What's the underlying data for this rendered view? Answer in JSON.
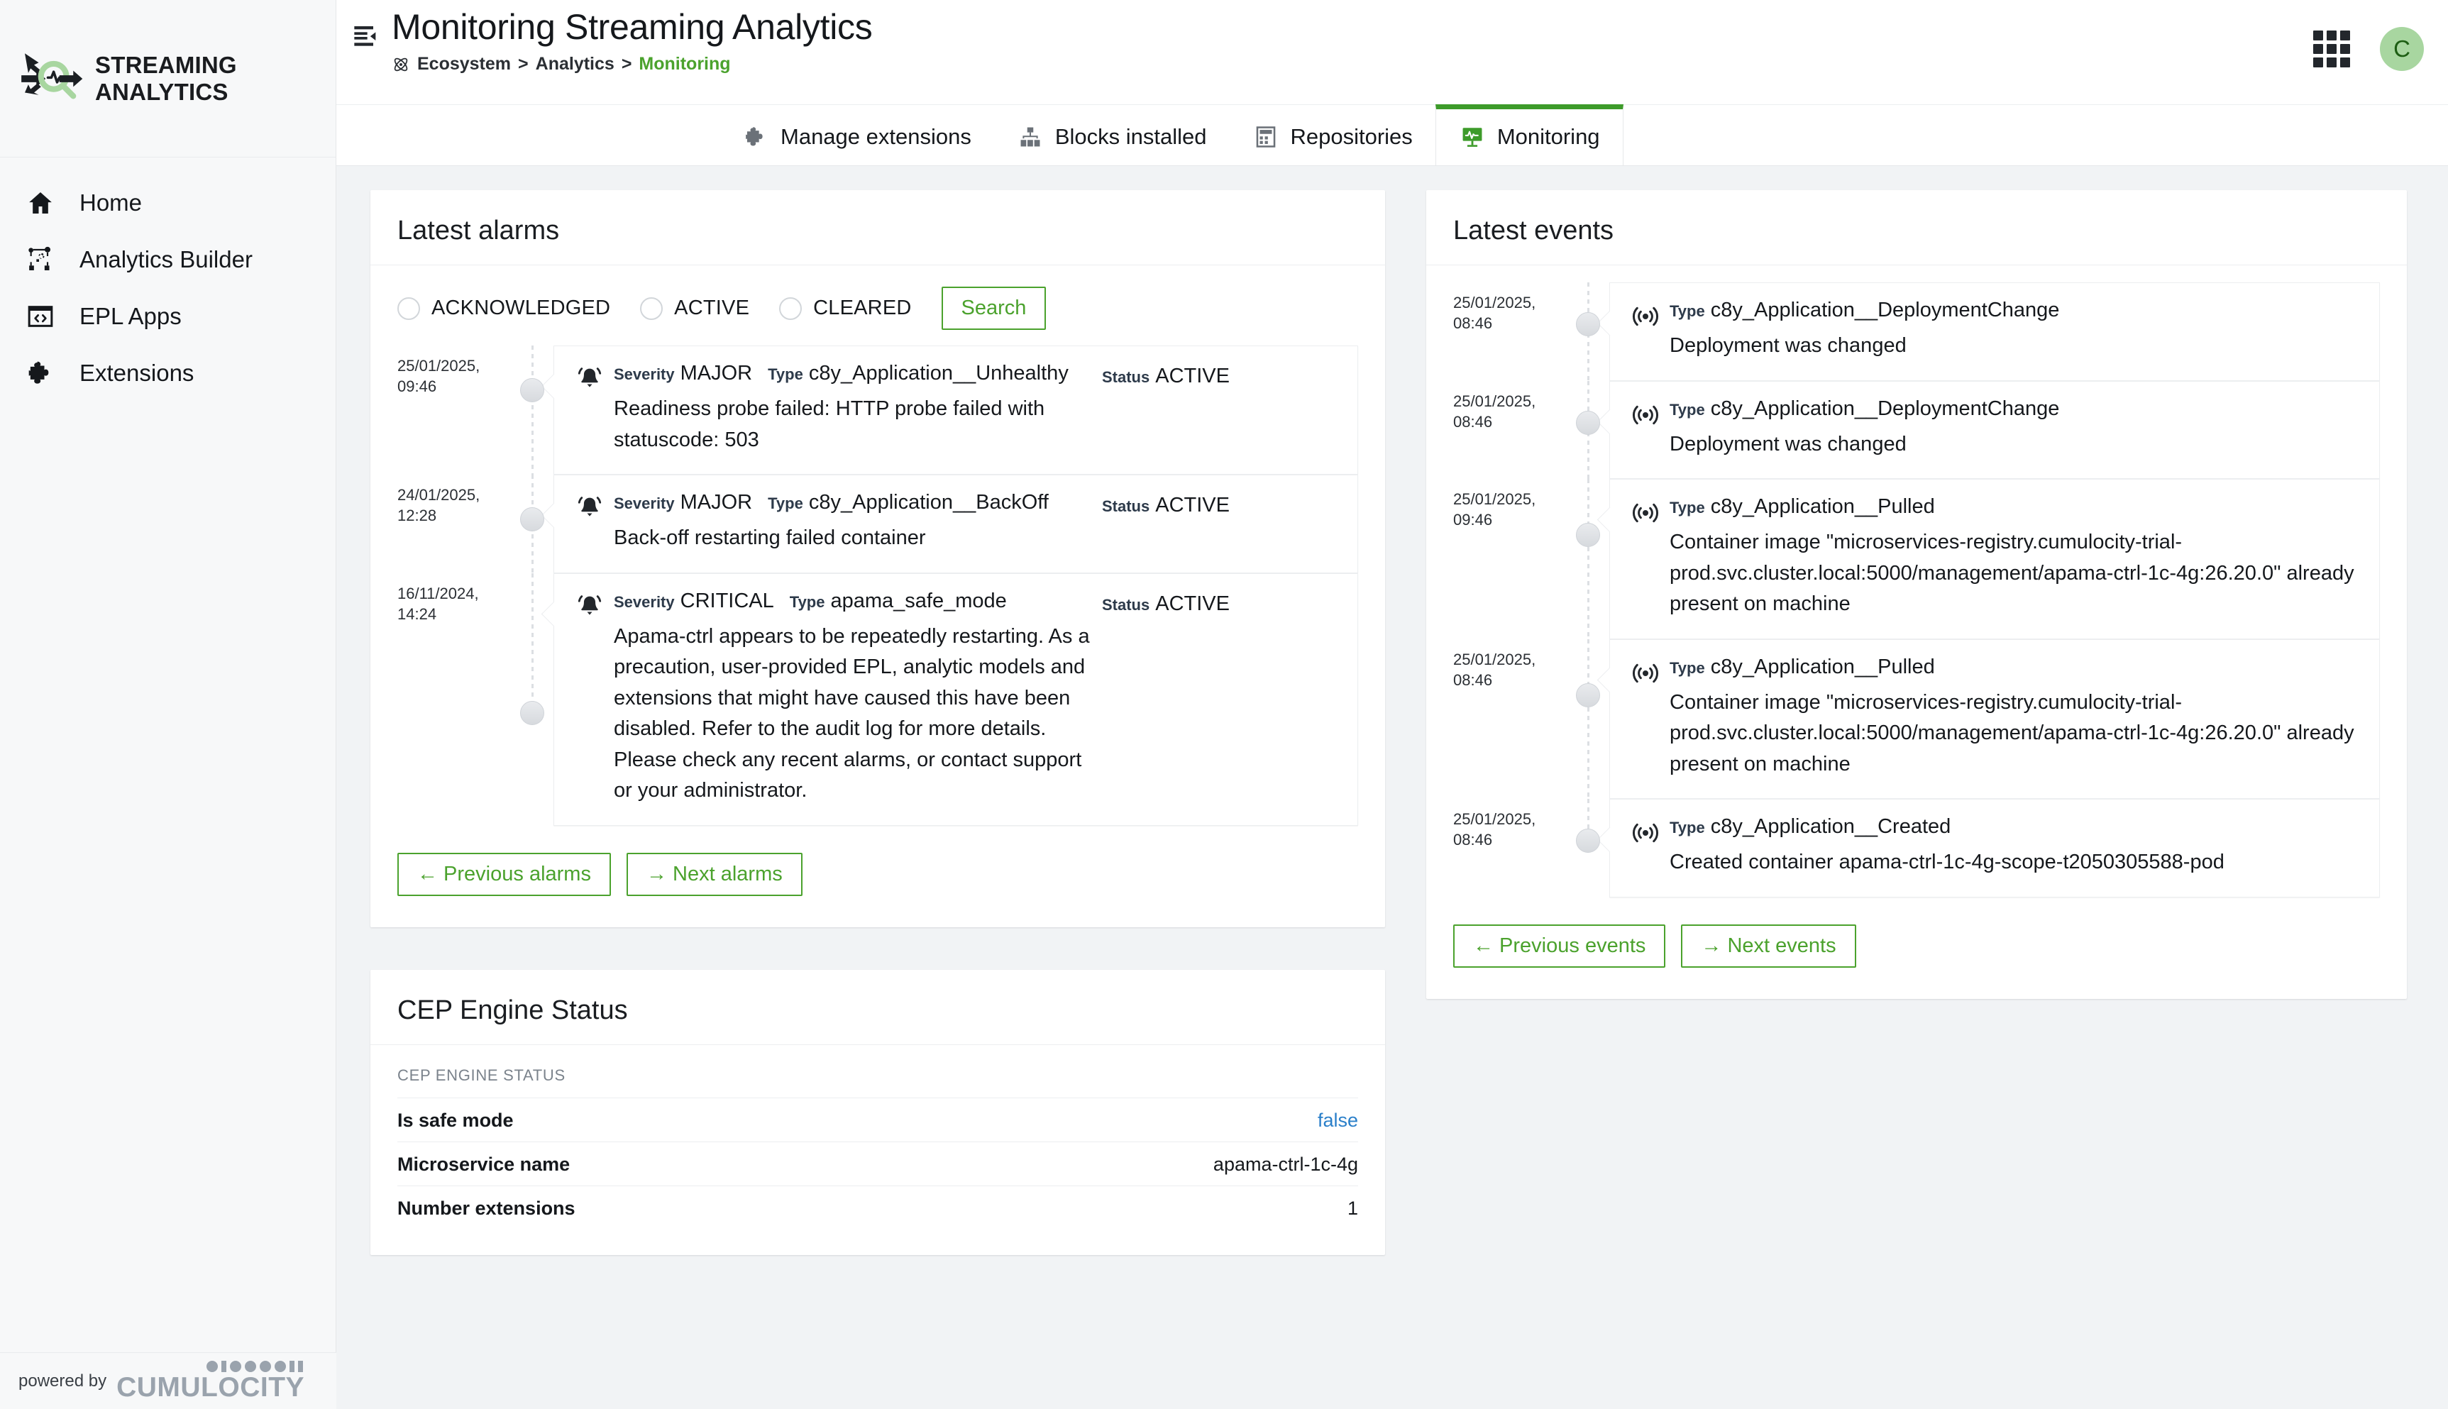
{
  "brand": {
    "name_line1": "STREAMING",
    "name_line2": "ANALYTICS",
    "logo_icon": "streaming-analytics-logo",
    "accent_green": "#4ba22d",
    "logo_green": "#a8d6a0"
  },
  "sidebar": {
    "items": [
      {
        "label": "Home",
        "icon": "home-icon"
      },
      {
        "label": "Analytics Builder",
        "icon": "analytics-builder-icon"
      },
      {
        "label": "EPL Apps",
        "icon": "epl-apps-icon"
      },
      {
        "label": "Extensions",
        "icon": "puzzle-piece-icon"
      }
    ],
    "footer": {
      "powered_by": "powered by",
      "product": "CUMULOCITY"
    }
  },
  "header": {
    "collapse_icon": "collapse-sidebar-icon",
    "title": "Monitoring Streaming Analytics",
    "breadcrumb": {
      "icon": "ecosystem-icon",
      "items": [
        "Ecosystem",
        "Analytics",
        "Monitoring"
      ],
      "separator": ">",
      "current_index": 2
    },
    "app_switcher_icon": "grid-apps-icon",
    "avatar_initial": "C"
  },
  "tabs": [
    {
      "label": "Manage extensions",
      "icon": "puzzle-piece-icon",
      "active": false
    },
    {
      "label": "Blocks installed",
      "icon": "blocks-hierarchy-icon",
      "active": false
    },
    {
      "label": "Repositories",
      "icon": "repository-icon",
      "active": false
    },
    {
      "label": "Monitoring",
      "icon": "monitoring-pulse-icon",
      "active": true
    }
  ],
  "alarms_panel": {
    "title": "Latest alarms",
    "filters": [
      {
        "label": "ACKNOWLEDGED",
        "selected": false
      },
      {
        "label": "ACTIVE",
        "selected": false
      },
      {
        "label": "CLEARED",
        "selected": false
      }
    ],
    "search_label": "Search",
    "labels": {
      "severity": "Severity",
      "type": "Type",
      "status": "Status"
    },
    "items": [
      {
        "date": "25/01/2025,",
        "time": "09:46",
        "icon": "alarm-bell-icon",
        "severity": "MAJOR",
        "type": "c8y_Application__Unhealthy",
        "status": "ACTIVE",
        "text": "Readiness probe failed: HTTP probe failed with statuscode: 503"
      },
      {
        "date": "24/01/2025,",
        "time": "12:28",
        "icon": "alarm-bell-icon",
        "severity": "MAJOR",
        "type": "c8y_Application__BackOff",
        "status": "ACTIVE",
        "text": "Back-off restarting failed container"
      },
      {
        "date": "16/11/2024,",
        "time": "14:24",
        "icon": "alarm-bell-icon",
        "severity": "CRITICAL",
        "type": "apama_safe_mode",
        "status": "ACTIVE",
        "text": "Apama-ctrl appears to be repeatedly restarting. As a precaution, user-provided EPL, analytic models and extensions that might have caused this have been disabled. Refer to the audit log for more details. Please check any recent alarms, or contact support or your administrator."
      }
    ],
    "prev_label": "←  Previous alarms",
    "next_label": "→  Next alarms"
  },
  "events_panel": {
    "title": "Latest events",
    "labels": {
      "type": "Type"
    },
    "items": [
      {
        "date": "25/01/2025,",
        "time": "08:46",
        "icon": "event-signal-icon",
        "type": "c8y_Application__DeploymentChange",
        "text": "Deployment was changed"
      },
      {
        "date": "25/01/2025,",
        "time": "08:46",
        "icon": "event-signal-icon",
        "type": "c8y_Application__DeploymentChange",
        "text": "Deployment was changed"
      },
      {
        "date": "25/01/2025,",
        "time": "09:46",
        "icon": "event-signal-icon",
        "type": "c8y_Application__Pulled",
        "text": "Container image \"microservices-registry.cumulocity-trial-prod.svc.cluster.local:5000/management/apama-ctrl-1c-4g:26.20.0\" already present on machine"
      },
      {
        "date": "25/01/2025,",
        "time": "08:46",
        "icon": "event-signal-icon",
        "type": "c8y_Application__Pulled",
        "text": "Container image \"microservices-registry.cumulocity-trial-prod.svc.cluster.local:5000/management/apama-ctrl-1c-4g:26.20.0\" already present on machine"
      },
      {
        "date": "25/01/2025,",
        "time": "08:46",
        "icon": "event-signal-icon",
        "type": "c8y_Application__Created",
        "text": "Created container apama-ctrl-1c-4g-scope-t2050305588-pod"
      }
    ],
    "prev_label": "←  Previous events",
    "next_label": "→  Next events"
  },
  "cep_panel": {
    "title": "CEP Engine Status",
    "legend": "CEP ENGINE STATUS",
    "rows": [
      {
        "label": "Is safe mode",
        "value": "false",
        "is_link": true
      },
      {
        "label": "Microservice name",
        "value": "apama-ctrl-1c-4g",
        "is_link": false
      },
      {
        "label": "Number extensions",
        "value": "1",
        "is_link": false
      }
    ]
  }
}
